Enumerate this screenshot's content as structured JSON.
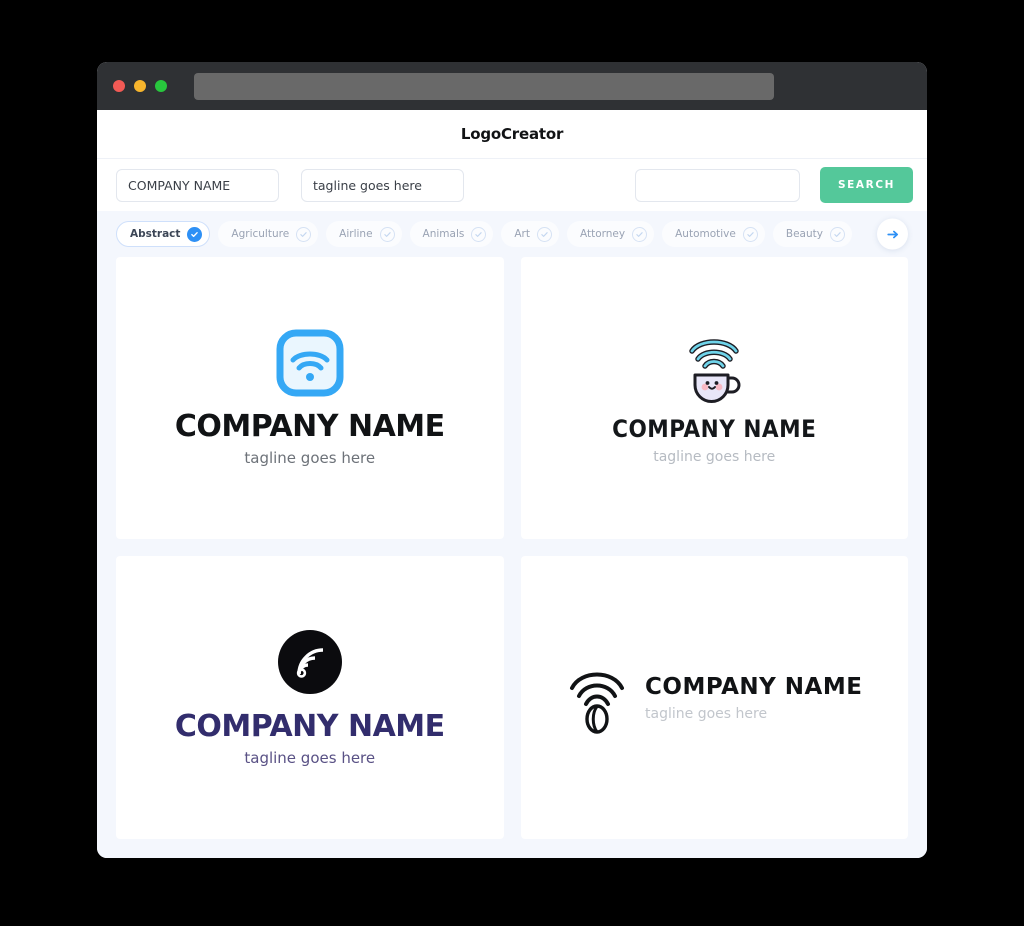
{
  "window": {
    "traffic_lights": [
      "close",
      "minimize",
      "maximize"
    ],
    "url_value": ""
  },
  "header": {
    "title": "LogoCreator"
  },
  "search": {
    "company_value": "COMPANY NAME",
    "company_placeholder": "COMPANY NAME",
    "tagline_value": "tagline goes here",
    "tagline_placeholder": "tagline goes here",
    "keyword_value": "",
    "keyword_placeholder": "",
    "button_label": "SEARCH",
    "button_color": "#54c89a"
  },
  "categories": {
    "accent_color": "#2e90f5",
    "next_icon": "arrow-right-icon",
    "items": [
      {
        "label": "Abstract",
        "selected": true
      },
      {
        "label": "Agriculture",
        "selected": false
      },
      {
        "label": "Airline",
        "selected": false
      },
      {
        "label": "Animals",
        "selected": false
      },
      {
        "label": "Art",
        "selected": false
      },
      {
        "label": "Attorney",
        "selected": false
      },
      {
        "label": "Automotive",
        "selected": false
      },
      {
        "label": "Beauty",
        "selected": false
      }
    ]
  },
  "results": [
    {
      "icon": "wifi-rounded-square-icon",
      "company": "COMPANY NAME",
      "tagline": "tagline goes here",
      "text_color": "#111315",
      "icon_color": "#35a8f5"
    },
    {
      "icon": "wifi-coffee-cup-kawaii-icon",
      "company": "COMPANY NAME",
      "tagline": "tagline goes here",
      "text_color": "#14171a",
      "icon_color": "#67d4e8"
    },
    {
      "icon": "wifi-circle-badge-icon",
      "company": "COMPANY NAME",
      "tagline": "tagline goes here",
      "text_color": "#322d6d",
      "icon_color": "#0b0b0e"
    },
    {
      "icon": "wifi-coffee-bean-outline-icon",
      "company": "COMPANY NAME",
      "tagline": "tagline goes here",
      "text_color": "#111315",
      "icon_color": "#111315"
    }
  ]
}
